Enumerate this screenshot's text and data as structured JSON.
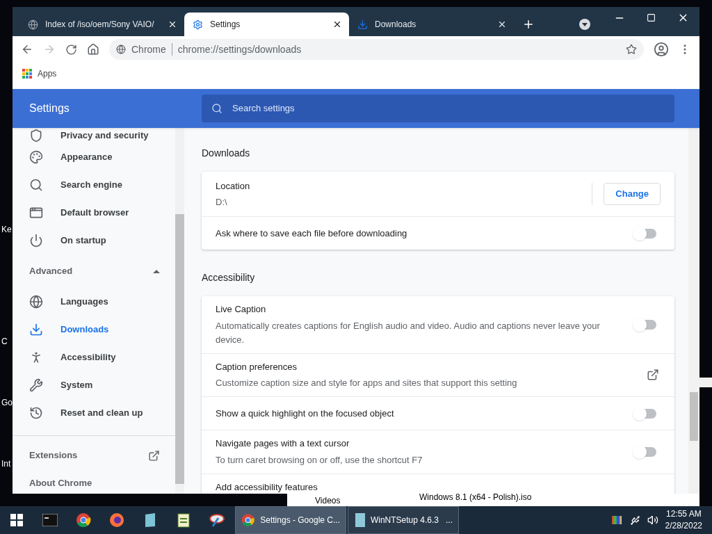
{
  "desktop": {
    "icon_labels": [
      "Ke",
      "C",
      "Go",
      "Int"
    ]
  },
  "background_window": {
    "items": [
      "Videos",
      "Windows 8.1 (x64 - Polish).iso"
    ]
  },
  "browser": {
    "tabs": [
      {
        "title": "Index of /iso/oem/Sony VAIO/",
        "selected": false
      },
      {
        "title": "Settings",
        "selected": true
      },
      {
        "title": "Downloads",
        "selected": false
      }
    ],
    "address_bar": {
      "chip": "Chrome",
      "url": "chrome://settings/downloads"
    },
    "bookmarks": [
      "Apps"
    ]
  },
  "settings": {
    "title": "Settings",
    "search": {
      "placeholder": "Search settings"
    },
    "sidebar": {
      "items": [
        {
          "label": "Privacy and security",
          "selected": false
        },
        {
          "label": "Appearance",
          "selected": false
        },
        {
          "label": "Search engine",
          "selected": false
        },
        {
          "label": "Default browser",
          "selected": false
        },
        {
          "label": "On startup",
          "selected": false
        }
      ],
      "advanced": {
        "label": "Advanced",
        "expanded": true
      },
      "advanced_items": [
        {
          "label": "Languages",
          "selected": false
        },
        {
          "label": "Downloads",
          "selected": true
        },
        {
          "label": "Accessibility",
          "selected": false
        },
        {
          "label": "System",
          "selected": false
        },
        {
          "label": "Reset and clean up",
          "selected": false
        }
      ],
      "footer": [
        {
          "label": "Extensions",
          "kind": "external"
        },
        {
          "label": "About Chrome",
          "kind": "plain"
        }
      ]
    },
    "sections": [
      {
        "heading": "Downloads",
        "rows": [
          {
            "kind": "location",
            "label": "Location",
            "value": "D:\\",
            "button": "Change"
          },
          {
            "kind": "toggle",
            "label": "Ask where to save each file before downloading",
            "on": false
          }
        ]
      },
      {
        "heading": "Accessibility",
        "rows": [
          {
            "kind": "toggle",
            "label": "Live Caption",
            "description": "Automatically creates captions for English audio and video. Audio and captions never leave your device.",
            "on": false
          },
          {
            "kind": "external",
            "label": "Caption preferences",
            "description": "Customize caption size and style for apps and sites that support this setting"
          },
          {
            "kind": "toggle",
            "label": "Show a quick highlight on the focused object",
            "on": false
          },
          {
            "kind": "toggle",
            "label": "Navigate pages with a text cursor",
            "description": "To turn caret browsing on or off, use the shortcut F7",
            "on": false
          },
          {
            "kind": "plain",
            "label": "Add accessibility features"
          }
        ]
      }
    ]
  },
  "taskbar": {
    "windows": [
      {
        "label": "Settings - Google C...",
        "selected": true
      },
      {
        "label": "WinNTSetup 4.6.3   ...",
        "selected": false
      }
    ],
    "clock": {
      "time": "12:55 AM",
      "date": "2/28/2022"
    }
  }
}
